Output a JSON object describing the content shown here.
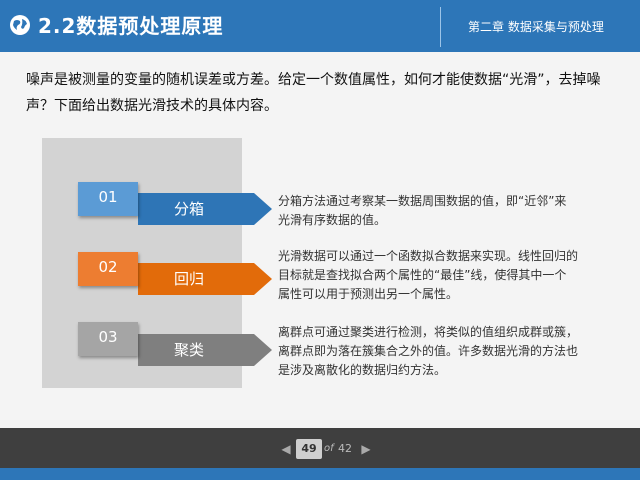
{
  "header": {
    "title": "2.2数据预处理原理",
    "chapter": "第二章 数据采集与预处理",
    "icon": "globe-icon",
    "color": "#2d76b8"
  },
  "intro": "噪声是被测量的变量的随机误差或方差。给定一个数值属性，如何才能使数据“光滑”，去掉噪声？下面给出数据光滑技术的具体内容。",
  "items": [
    {
      "number": "01",
      "label": "分箱",
      "description": "分箱方法通过考察某一数据周围数据的值，即“近邻”来光滑有序数据的值。",
      "box_color": "#5b9bd5",
      "ribbon_color": "#2e75b6"
    },
    {
      "number": "02",
      "label": "回归",
      "description": "光滑数据可以通过一个函数拟合数据来实现。线性回归的目标就是查找拟合两个属性的“最佳”线，使得其中一个属性可以用于预测出另一个属性。",
      "box_color": "#ed7d31",
      "ribbon_color": "#e26b0a"
    },
    {
      "number": "03",
      "label": "聚类",
      "description": "离群点可通过聚类进行检测，将类似的值组织成群或簇，离群点即为落在簇集合之外的值。许多数据光滑的方法也是涉及离散化的数据归约方法。",
      "box_color": "#a5a5a5",
      "ribbon_color": "#7f7f7f"
    }
  ],
  "footer": {
    "current_page": "49",
    "of_label": "of",
    "total_pages": "42",
    "prev_icon": "chevron-left-icon",
    "next_icon": "chevron-right-icon"
  }
}
